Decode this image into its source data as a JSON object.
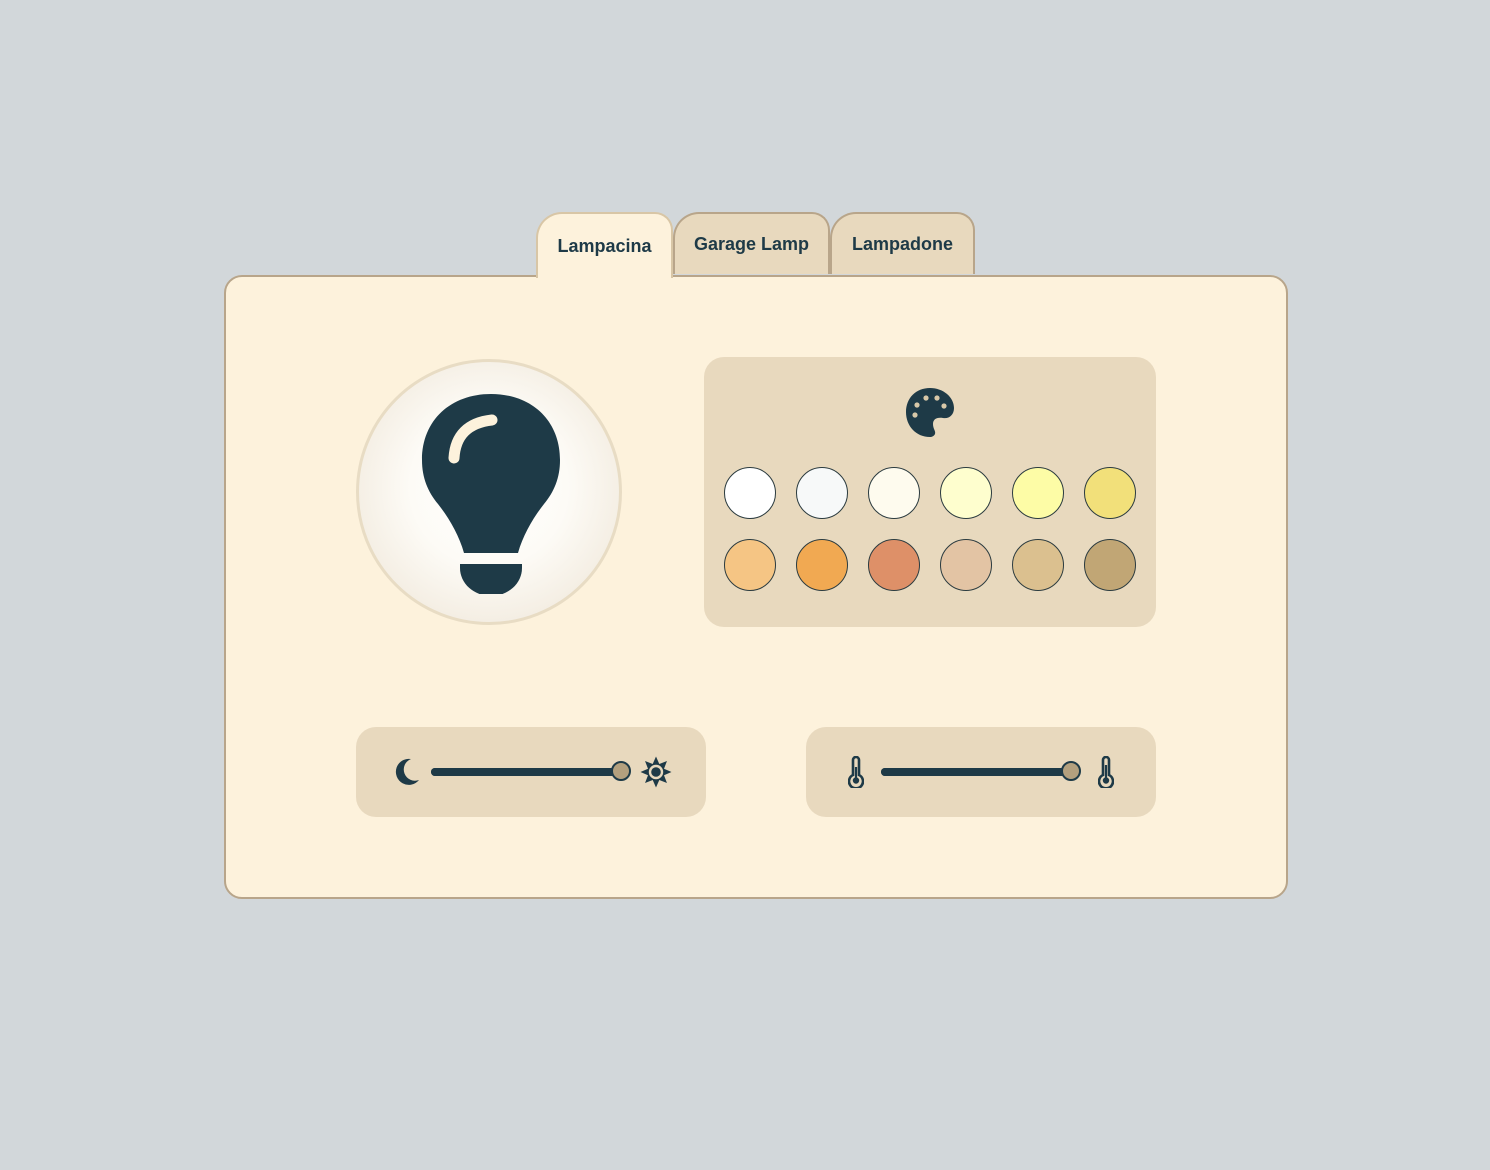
{
  "tabs": [
    {
      "label": "Lampacina",
      "active": true
    },
    {
      "label": "Garage Lamp",
      "active": false
    },
    {
      "label": "Lampadone",
      "active": false
    }
  ],
  "colors": {
    "icon": "#1e3a47",
    "panel_background": "#fdf2dc",
    "card_background": "#e8d9be",
    "page_background": "#d2d7da",
    "slider_thumb": "#b3a07e"
  },
  "lamp": {
    "icon": "lightbulb-icon"
  },
  "palette": {
    "icon": "palette-icon",
    "swatches": [
      "#ffffff",
      "#f7f9f9",
      "#fefbee",
      "#fefece",
      "#fdfca6",
      "#f2e07a",
      "#f5c584",
      "#f1a952",
      "#de9068",
      "#e3c4a4",
      "#dbc08f",
      "#c1a675"
    ]
  },
  "brightness": {
    "left_icon": "moon-icon",
    "right_icon": "sun-icon",
    "value": 1.0
  },
  "temperature": {
    "left_icon": "thermometer-low-icon",
    "right_icon": "thermometer-high-icon",
    "value": 1.0
  }
}
